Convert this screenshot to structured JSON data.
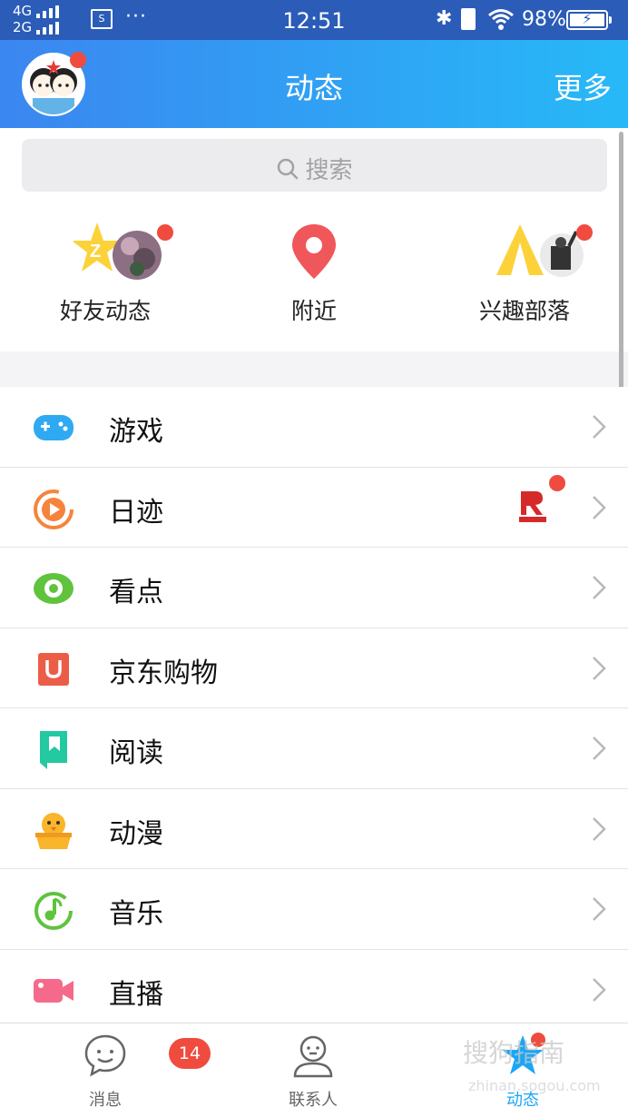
{
  "status_bar": {
    "network_top": "4G",
    "network_bottom": "2G",
    "screenshot_glyph": "S",
    "more": "···",
    "time": "12:51",
    "bluetooth": "✱",
    "battery_pct": "98%",
    "battery_bolt": "⚡"
  },
  "header": {
    "title": "动态",
    "more": "更多"
  },
  "search": {
    "placeholder": "搜索"
  },
  "quick_links": [
    {
      "label": "好友动态"
    },
    {
      "label": "附近"
    },
    {
      "label": "兴趣部落"
    }
  ],
  "list": [
    {
      "label": "游戏",
      "icon": "gamepad-icon",
      "color": "#2fa9f2"
    },
    {
      "label": "日迹",
      "icon": "play-circle-icon",
      "color": "#f7843c"
    },
    {
      "label": "看点",
      "icon": "eye-icon",
      "color": "#5fc33e"
    },
    {
      "label": "京东购物",
      "icon": "u-bag-icon",
      "color": "#ec5d47"
    },
    {
      "label": "阅读",
      "icon": "book-icon",
      "color": "#23c9a1"
    },
    {
      "label": "动漫",
      "icon": "chick-icon",
      "color": "#f9b52b"
    },
    {
      "label": "音乐",
      "icon": "music-icon",
      "color": "#5fc33e"
    },
    {
      "label": "直播",
      "icon": "camera-icon",
      "color": "#f56a8a"
    }
  ],
  "tabs": [
    {
      "label": "消息",
      "badge": "14"
    },
    {
      "label": "联系人"
    },
    {
      "label": "动态"
    }
  ],
  "watermark": {
    "main": "搜狗指南",
    "sub": "zhinan.sogou.com"
  },
  "colors": {
    "accent": "#1aa6f6",
    "header_start": "#3b86f0",
    "header_end": "#27b9f7",
    "badge": "#f04b3f"
  }
}
